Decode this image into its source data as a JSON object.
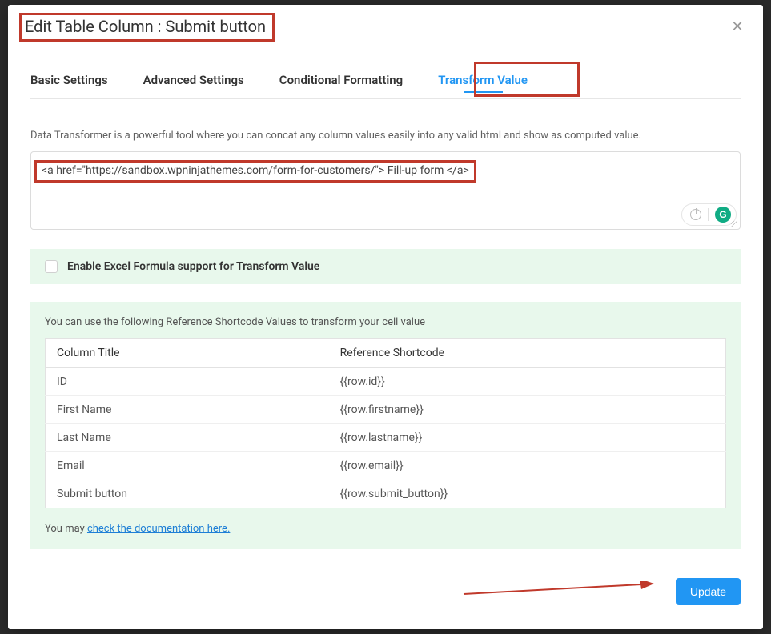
{
  "header": {
    "title": "Edit Table Column : Submit button"
  },
  "tabs": {
    "basic": "Basic Settings",
    "advanced": "Advanced Settings",
    "conditional": "Conditional Formatting",
    "transform": "Transform Value"
  },
  "help": "Data Transformer is a powerful tool where you can concat any column values easily into any valid html and show as computed value.",
  "editor": {
    "value": "<a href=\"https://sandbox.wpninjathemes.com/form-for-customers/\"> Fill-up form </a>",
    "grammarly_badge": "G"
  },
  "excel": {
    "label": "Enable Excel Formula support for Transform Value"
  },
  "ref_panel": {
    "help": "You can use the following Reference Shortcode Values to transform your cell value",
    "col_a": "Column Title",
    "col_b": "Reference Shortcode",
    "rows": [
      {
        "a": "ID",
        "b": "{{row.id}}"
      },
      {
        "a": "First Name",
        "b": "{{row.firstname}}"
      },
      {
        "a": "Last Name",
        "b": "{{row.lastname}}"
      },
      {
        "a": "Email",
        "b": "{{row.email}}"
      },
      {
        "a": "Submit button",
        "b": "{{row.submit_button}}"
      }
    ],
    "doc_prefix": "You may ",
    "doc_link": "check the documentation here."
  },
  "footer": {
    "update": "Update"
  }
}
